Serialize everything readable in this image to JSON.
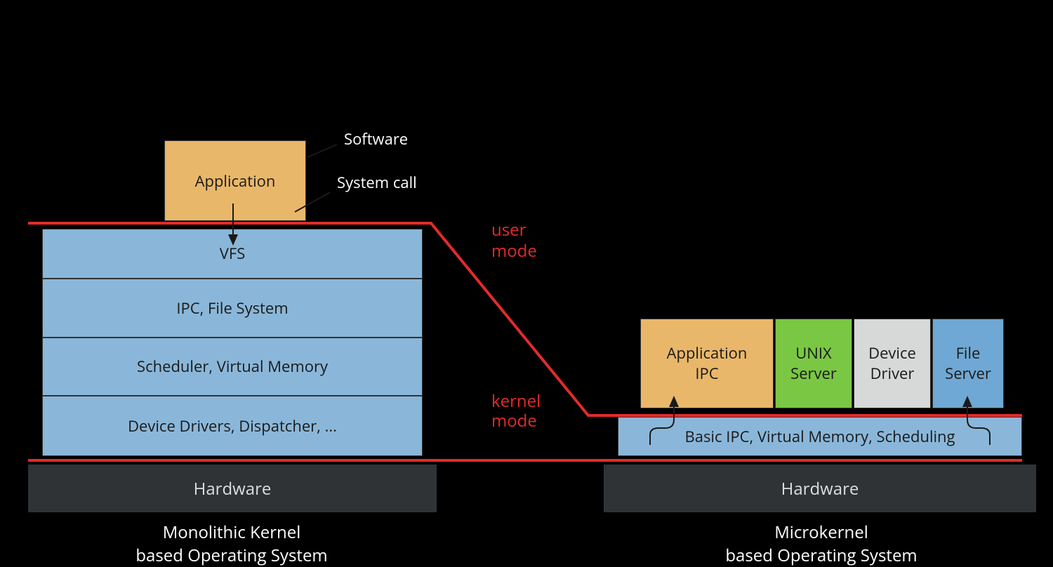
{
  "left": {
    "title_top": "Monolithic Kernel",
    "title_bottom": "based Operating System",
    "application": "Application",
    "kernel_layers": [
      "VFS",
      "IPC, File System",
      "Scheduler, Virtual Memory",
      "Device Drivers, Dispatcher, ..."
    ],
    "hardware": "Hardware"
  },
  "right": {
    "title_top": "Microkernel",
    "title_bottom": "based Operating System",
    "servers": [
      {
        "label_line1": "Application",
        "label_line2": "IPC",
        "class": "col-app"
      },
      {
        "label_line1": "UNIX",
        "label_line2": "Server",
        "class": "col-unix"
      },
      {
        "label_line1": "Device",
        "label_line2": "Driver",
        "class": "col-driver"
      },
      {
        "label_line1": "File",
        "label_line2": "Server",
        "class": "col-file"
      }
    ],
    "microkernel": "Basic IPC, Virtual Memory, Scheduling",
    "hardware": "Hardware"
  },
  "mode_labels": {
    "user_top": "user",
    "user_bottom": "mode",
    "kernel_top": "kernel",
    "kernel_bottom": "mode"
  },
  "annotations": {
    "system_call": "System call",
    "software": "Software"
  },
  "colors": {
    "red": "#e22b2b",
    "app": "#e9b76a",
    "kernel": "#8ab7d9",
    "unix": "#7ac743",
    "driver": "#d6d9d7",
    "file": "#6fa8d4",
    "hardware": "#2f3336"
  }
}
